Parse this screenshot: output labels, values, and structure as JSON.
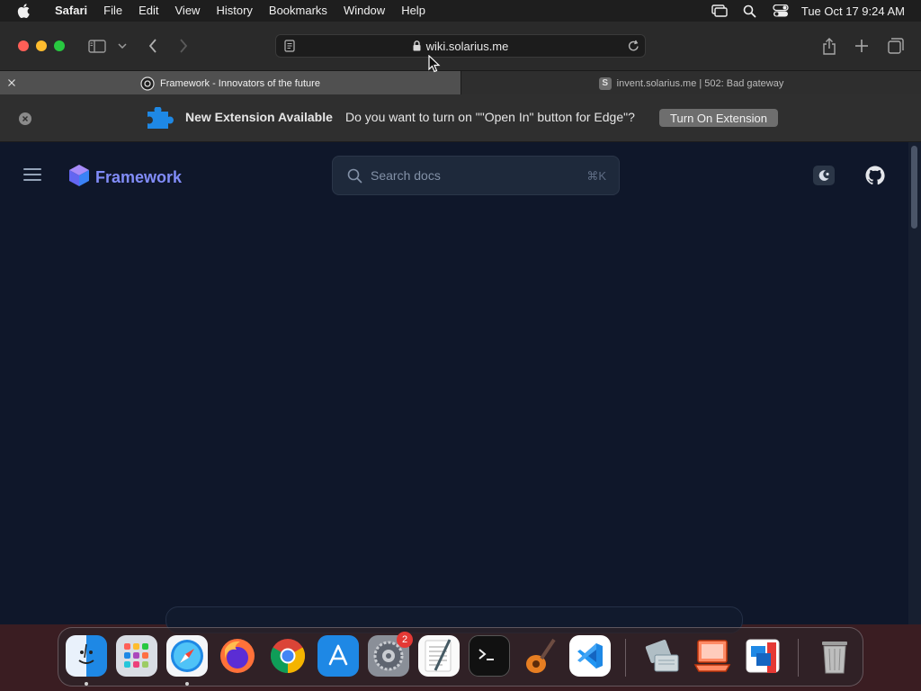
{
  "menubar": {
    "app_name": "Safari",
    "items": [
      "File",
      "Edit",
      "View",
      "History",
      "Bookmarks",
      "Window",
      "Help"
    ],
    "clock": "Tue Oct 17  9:24 AM"
  },
  "browser": {
    "url": "wiki.solarius.me",
    "tabs": [
      {
        "title": "Framework - Innovators of the future",
        "active": true
      },
      {
        "title": "invent.solarius.me | 502: Bad gateway",
        "active": false,
        "favicon_letter": "S"
      }
    ]
  },
  "extension_bar": {
    "title": "New Extension Available",
    "message": "Do you want to turn on \"\"Open In\" button for Edge\"?",
    "button_label": "Turn On Extension"
  },
  "page": {
    "brand": "Framework",
    "search_placeholder": "Search docs",
    "search_shortcut": "⌘K"
  },
  "dock": {
    "apps": [
      "finder",
      "launchpad",
      "safari",
      "firefox",
      "chrome",
      "app-store",
      "system-settings",
      "textedit",
      "terminal",
      "garageband",
      "vscode",
      "boot-camp",
      "remote-desktop",
      "parallels",
      "trash"
    ],
    "system_settings_badge": "2"
  },
  "colors": {
    "page_bg": "#0f172a",
    "brand": "#818cf8",
    "accent_close": "#ff5f57",
    "accent_min": "#febc2e",
    "accent_max": "#28c840"
  }
}
